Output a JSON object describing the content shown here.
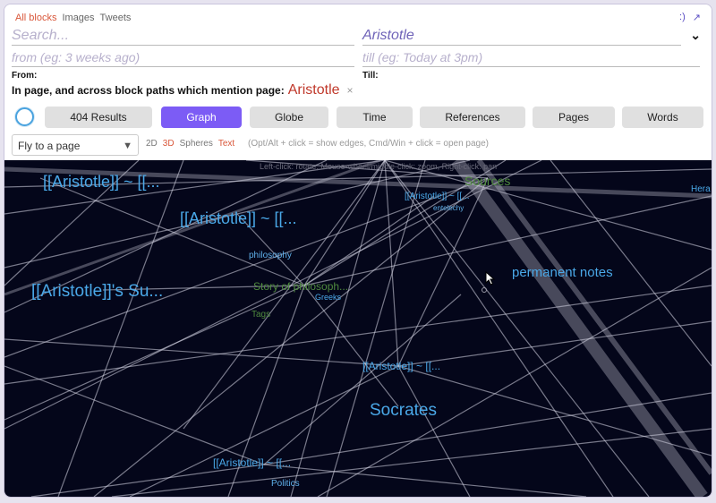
{
  "tabs": [
    "All blocks",
    "Images",
    "Tweets"
  ],
  "corner": {
    "smiley": ":)",
    "expand_icon": "arrow-up-right-icon"
  },
  "search": {
    "placeholder": "Search...",
    "from_placeholder": "from (eg: 3 weeks ago)"
  },
  "page_field": {
    "value": "Aristotle",
    "till_placeholder": "till (eg: Today at 3pm)"
  },
  "labels": {
    "from": "From:",
    "till": "Till:"
  },
  "mention": {
    "text": "In page, and across block paths which mention page:",
    "page": "Aristotle",
    "remove": "×"
  },
  "buttons": {
    "results": "404 Results",
    "graph": "Graph",
    "globe": "Globe",
    "time": "Time",
    "references": "References",
    "pages": "Pages",
    "words": "Words"
  },
  "fly_to": {
    "value": "Fly to a page"
  },
  "modes": {
    "d2": "2D",
    "d3": "3D",
    "spheres": "Spheres",
    "text": "Text"
  },
  "hint": "(Opt/Alt + click = show edges, Cmd/Win + click = open page)",
  "graph": {
    "overlay_hint": "Left-click: rotate, Mouse-wheel/middle-click: zoom, Right-click: pan",
    "nodes": [
      {
        "label": "[[Aristotle]] ~ [[...",
        "color": "#4aa8e8"
      },
      {
        "label": "[[Aristotle]] ~ [[...",
        "color": "#4aa8e8"
      },
      {
        "label": "[[Aristotle]]'s Su...",
        "color": "#4aa8e8"
      },
      {
        "label": "philosophy",
        "color": "#5fb0ea"
      },
      {
        "label": "Story of philosoph...",
        "color": "#4f8a3e"
      },
      {
        "label": "Greeks",
        "color": "#4aa8e8"
      },
      {
        "label": "Tags",
        "color": "#4f8a3e"
      },
      {
        "label": "Sources",
        "color": "#4f8a3e"
      },
      {
        "label": "[[Aristotle]] ~ [[...",
        "color": "#4aa8e8"
      },
      {
        "label": "entelechy",
        "color": "#5fb0ea"
      },
      {
        "label": "Hera",
        "color": "#4aa8e8"
      },
      {
        "label": "permanent notes",
        "color": "#4aa8e8"
      },
      {
        "label": "[[Aristotle]] ~ [[...",
        "color": "#4aa8e8"
      },
      {
        "label": "Socrates",
        "color": "#4aa8e8"
      },
      {
        "label": "[[Aristotle]] ~ [[...",
        "color": "#4aa8e8"
      },
      {
        "label": "Politics",
        "color": "#5fb0ea"
      }
    ]
  },
  "colors": {
    "accent": "#7c5cf5",
    "tab_active": "#d9573a",
    "page_red": "#c0392b",
    "graph_bg": "#04061a"
  }
}
